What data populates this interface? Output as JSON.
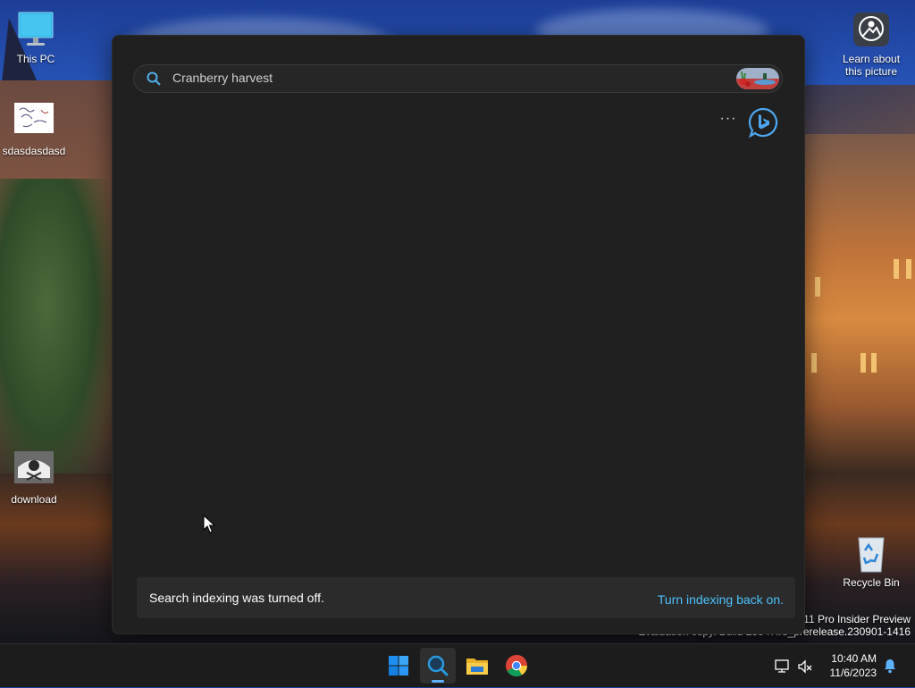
{
  "desktop": {
    "icons": [
      {
        "label": "This PC"
      },
      {
        "label": "sdasdasdasd"
      },
      {
        "label": "download"
      },
      {
        "label": "Learn about this picture"
      },
      {
        "label": "Recycle Bin"
      }
    ],
    "watermark": {
      "line1": "s 11 Pro Insider Preview",
      "line2": "Evaluation copy. Build 25947.rs_prerelease.230901-1416"
    }
  },
  "search": {
    "query": "Cranberry harvest",
    "more_label": "···",
    "indexing_message": "Search indexing was turned off.",
    "indexing_link": "Turn indexing back on."
  },
  "taskbar": {
    "apps": [
      {
        "icon": "windows-start-icon",
        "active": false
      },
      {
        "icon": "search-icon",
        "active": true
      },
      {
        "icon": "file-explorer-icon",
        "active": false
      },
      {
        "icon": "chrome-icon",
        "active": false
      }
    ],
    "time": "10:40 AM",
    "date": "11/6/2023"
  },
  "colors": {
    "accent": "#4cc2ff",
    "panel_bg": "#202020",
    "taskbar_bg": "#1c1c1c"
  }
}
